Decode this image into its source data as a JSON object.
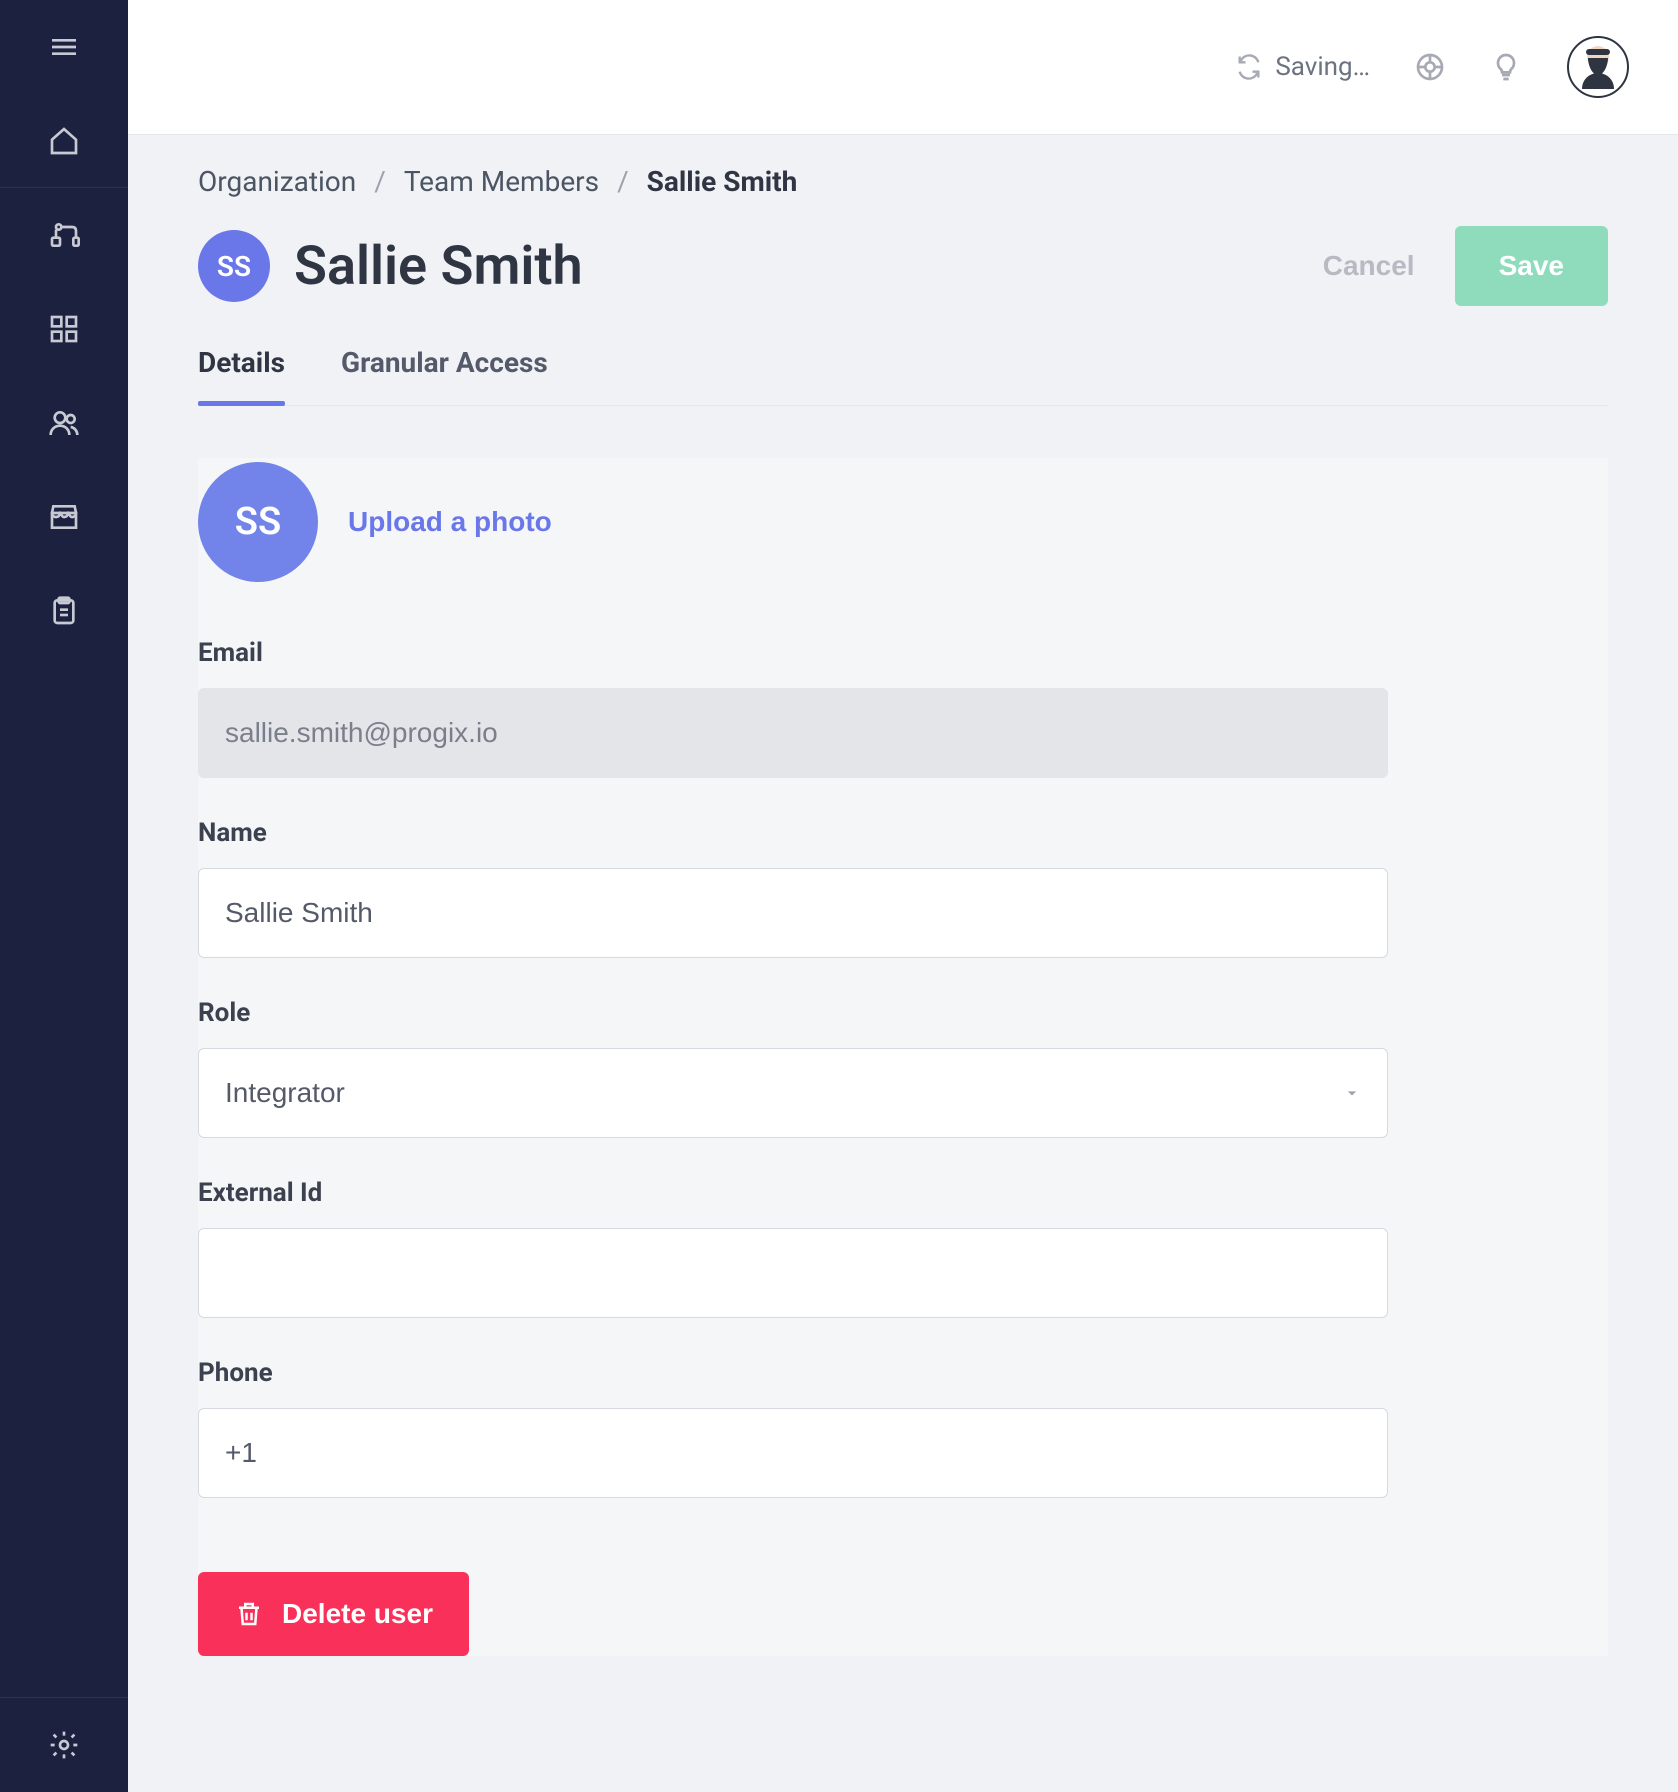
{
  "topbar": {
    "status_text": "Saving…"
  },
  "breadcrumb": {
    "items": [
      "Organization",
      "Team Members",
      "Sallie Smith"
    ]
  },
  "page": {
    "avatar_initials": "SS",
    "title": "Sallie Smith",
    "cancel_label": "Cancel",
    "save_label": "Save"
  },
  "tabs": {
    "details": "Details",
    "granular": "Granular Access"
  },
  "details": {
    "photo_initials": "SS",
    "upload_label": "Upload a photo",
    "email_label": "Email",
    "email_value": "sallie.smith@progix.io",
    "name_label": "Name",
    "name_value": "Sallie Smith",
    "role_label": "Role",
    "role_value": "Integrator",
    "externalid_label": "External Id",
    "externalid_value": "",
    "phone_label": "Phone",
    "phone_value": "+1",
    "delete_label": "Delete user"
  }
}
